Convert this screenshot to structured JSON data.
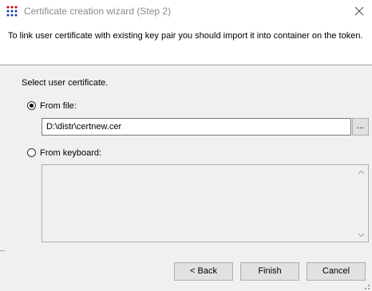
{
  "window": {
    "title": "Certificate creation wizard (Step 2)",
    "icon": "app-icon",
    "close_icon": "close-icon"
  },
  "header": {
    "text": "To link user certificate with existing key pair you should import it into container on the token."
  },
  "form": {
    "select_label": "Select user certificate.",
    "from_file_label": "From file:",
    "from_file_selected": true,
    "file_path": "D:\\distr\\certnew.cer",
    "browse_label": "...",
    "from_keyboard_label": "From keyboard:",
    "from_keyboard_selected": false,
    "keyboard_text": ""
  },
  "buttons": {
    "back": "< Back",
    "finish": "Finish",
    "cancel": "Cancel"
  },
  "colors": {
    "background": "#f0f0f0",
    "header_bg": "#ffffff",
    "title_text": "#8a8a8a",
    "button_bg": "#e1e1e1",
    "button_border": "#adadad"
  }
}
